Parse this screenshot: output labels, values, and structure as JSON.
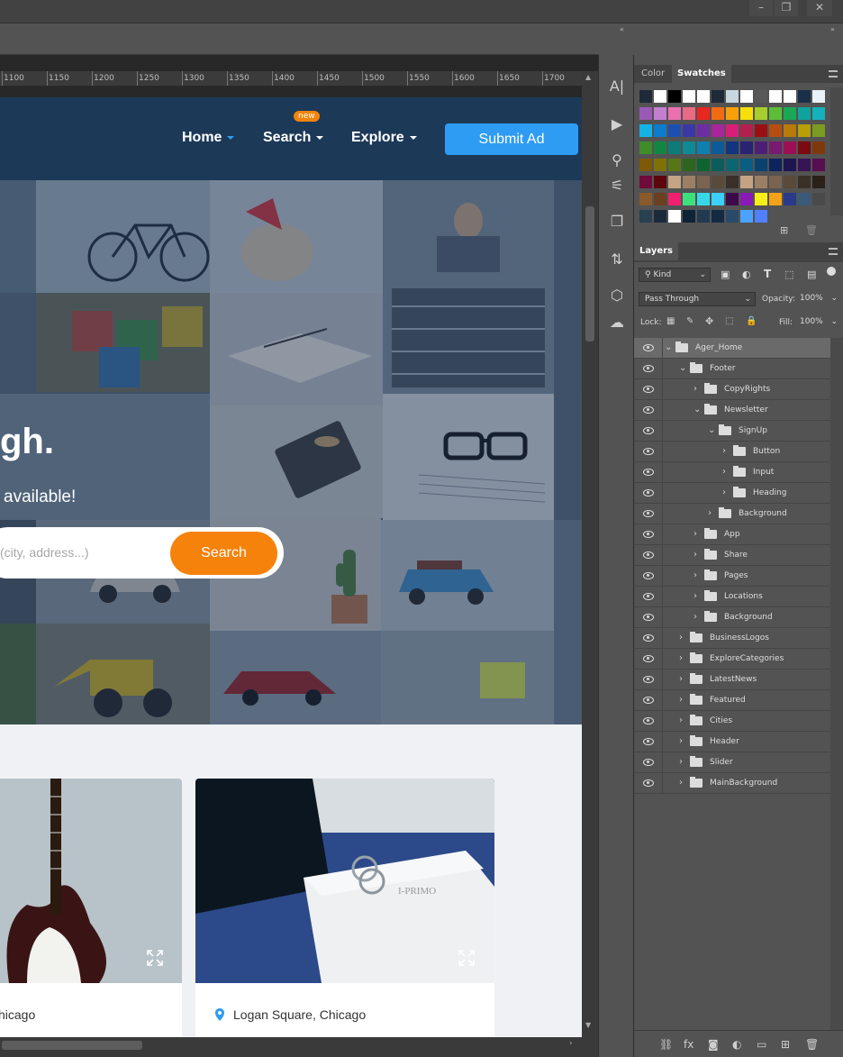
{
  "app": {
    "window_controls": [
      "–",
      "❐",
      "✕"
    ]
  },
  "ruler": {
    "ticks": [
      "1100",
      "1150",
      "1200",
      "1250",
      "1300",
      "1350",
      "1400",
      "1450",
      "1500",
      "1550",
      "1600",
      "1650",
      "1700"
    ]
  },
  "site": {
    "nav": [
      {
        "label": "Home"
      },
      {
        "label": "Search",
        "badge": "new"
      },
      {
        "label": "Explore"
      }
    ],
    "submit_label": "Submit Ad",
    "hero_title": "gh.",
    "hero_subtitle": "available!",
    "search_placeholder": "(city, address...)",
    "search_button": "Search",
    "cards": [
      {
        "location": "hicago"
      },
      {
        "location": "Logan Square, Chicago"
      }
    ]
  },
  "panel": {
    "tab_color": "Color",
    "tab_swatches": "Swatches",
    "tab_layers": "Layers",
    "kind_label": "Kind",
    "blend_mode": "Pass Through",
    "opacity_label": "Opacity:",
    "opacity_value": "100%",
    "lock_label": "Lock:",
    "fill_label": "Fill:",
    "fill_value": "100%"
  },
  "swatch_colors": [
    [
      "#1e2a38",
      "#ffffff",
      "#000000",
      "#ffffff",
      "#ffffff",
      "#1e2a38",
      "#c7d6e0",
      "#ffffff",
      "#585858",
      "#ffffff",
      "#ffffff",
      "#1a2f48",
      "#e8f2f8"
    ],
    [
      "#9b59b6",
      "#c27fd0",
      "#ec6fb0",
      "#e86a84",
      "#e8271f",
      "#f26b13",
      "#f7a10a",
      "#f7e00a",
      "#a6cf2d",
      "#5cbd37",
      "#19a854",
      "#0fa39d",
      "#13b2bd"
    ],
    [
      "#13b3e6",
      "#0d7ccd",
      "#1d4fb3",
      "#3a38a6",
      "#6d2ea4",
      "#a8259c",
      "#d81e78",
      "#b51f4d",
      "#9b0f12",
      "#b64e10",
      "#b87a08",
      "#b89e07",
      "#7b9c20"
    ],
    [
      "#3f8c2a",
      "#138542",
      "#0c7c79",
      "#0e8a95",
      "#0f7fb1",
      "#0c5a97",
      "#13347f",
      "#2a2373",
      "#4d1f74",
      "#781a70",
      "#9c0f55",
      "#7a0b11",
      "#7e390b"
    ],
    [
      "#7e5906",
      "#7e7206",
      "#577717",
      "#2c661e",
      "#0e6431",
      "#0a5d5a",
      "#0a6670",
      "#0a5d83",
      "#0a426e",
      "#0d235c",
      "#1d1653",
      "#371454",
      "#560f4f"
    ],
    [
      "#71093c",
      "#5c060b",
      "#c4a484",
      "#9b8066",
      "#7a6450",
      "#5a4a3a",
      "#3a3028",
      "#c4a484",
      "#9b8066",
      "#7a6450",
      "#5a4a3a",
      "#3a3028",
      "#2a2018"
    ],
    [
      "#8b5a2b",
      "#6a4020",
      "#f0206f",
      "#3de07a",
      "#38d7e8",
      "#3bd0ff",
      "#3c0a4a",
      "#8a1ab6",
      "#f5f01a",
      "#f5a21a",
      "#2a3a8a",
      "#3a5a7a",
      "#4a4a4a"
    ],
    [
      "#284050",
      "#1a2a3a",
      "#ffffff",
      "#0e2436",
      "#203a52",
      "#122a44",
      "#2a4a6a",
      "#4aa3ff",
      "#5080ff",
      "#535353",
      "#535353",
      "#535353",
      "#535353"
    ]
  ],
  "layers": [
    {
      "name": "Ager_Home",
      "depth": 0,
      "expanded": true,
      "selected": true
    },
    {
      "name": "Footer",
      "depth": 1,
      "expanded": true
    },
    {
      "name": "CopyRights",
      "depth": 2,
      "expanded": false
    },
    {
      "name": "Newsletter",
      "depth": 2,
      "expanded": true
    },
    {
      "name": "SignUp",
      "depth": 3,
      "expanded": true
    },
    {
      "name": "Button",
      "depth": 4,
      "expanded": false
    },
    {
      "name": "Input",
      "depth": 4,
      "expanded": false
    },
    {
      "name": "Heading",
      "depth": 4,
      "expanded": false
    },
    {
      "name": "Background",
      "depth": 3,
      "expanded": false
    },
    {
      "name": "App",
      "depth": 2,
      "expanded": false
    },
    {
      "name": "Share",
      "depth": 2,
      "expanded": false
    },
    {
      "name": "Pages",
      "depth": 2,
      "expanded": false
    },
    {
      "name": "Locations",
      "depth": 2,
      "expanded": false
    },
    {
      "name": "Background",
      "depth": 2,
      "expanded": false
    },
    {
      "name": "BusinessLogos",
      "depth": 1,
      "expanded": false
    },
    {
      "name": "ExploreCategories",
      "depth": 1,
      "expanded": false
    },
    {
      "name": "LatestNews",
      "depth": 1,
      "expanded": false
    },
    {
      "name": "Featured",
      "depth": 1,
      "expanded": false
    },
    {
      "name": "Cities",
      "depth": 1,
      "expanded": false
    },
    {
      "name": "Header",
      "depth": 1,
      "expanded": false
    },
    {
      "name": "Slider",
      "depth": 1,
      "expanded": false
    },
    {
      "name": "MainBackground",
      "depth": 1,
      "expanded": false
    }
  ],
  "bottom_icons": [
    "link-icon",
    "fx-icon",
    "mask-icon",
    "adjustment-icon",
    "new-group-icon",
    "new-layer-icon",
    "trash-icon"
  ]
}
